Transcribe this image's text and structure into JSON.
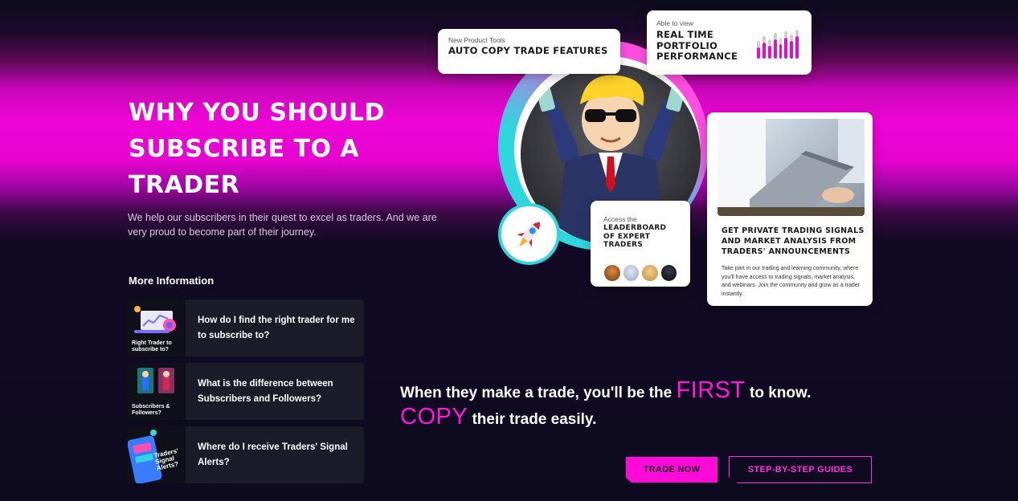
{
  "hero": {
    "title": "WHY YOU SHOULD SUBSCRIBE TO A TRADER",
    "subtitle": "We help our subscribers in their quest to excel as traders. And we are very proud to become part of their journey."
  },
  "more_info": {
    "heading": "More Information",
    "items": [
      {
        "thumb_caption": "Right Trader to subscribe to?",
        "question": "How do I find the right trader for me to subscribe to?"
      },
      {
        "thumb_caption": "Subscribers & Followers?",
        "question": "What is the difference between Subscribers and Followers?"
      },
      {
        "thumb_caption": "Traders' Signal Alerts?",
        "question": "Where do I receive Traders' Signal Alerts?"
      }
    ]
  },
  "cards": {
    "tools": {
      "small": "New Product Tools",
      "big": "AUTO COPY TRADE FEATURES"
    },
    "realtime": {
      "small": "Able to view",
      "big": "REAL TIME PORTFOLIO PERFORMANCE"
    },
    "leaderboard": {
      "small": "Access the",
      "big": "LEADERBOARD OF EXPERT TRADERS"
    },
    "signals": {
      "big": "GET PRIVATE TRADING SIGNALS AND MARKET ANALYSIS FROM TRADERS' ANNOUNCEMENTS",
      "desc": "Take part in our trading and learning community, where you'll have access to trading signals, market analysis, and webinars. Join the community and grow as a trader instantly."
    }
  },
  "tagline": {
    "line1_pre": "When they make a trade, you'll be the ",
    "line1_hl": "FIRST",
    "line1_post": " to know.",
    "line2_hl": "COPY",
    "line2_post": " their trade easily."
  },
  "buttons": {
    "trade_now": "TRADE NOW",
    "guides": "STEP-BY-STEP GUIDES"
  },
  "colors": {
    "accent": "#ff0ad8",
    "teal": "#2fd6de",
    "background": "#0d0a1f"
  }
}
